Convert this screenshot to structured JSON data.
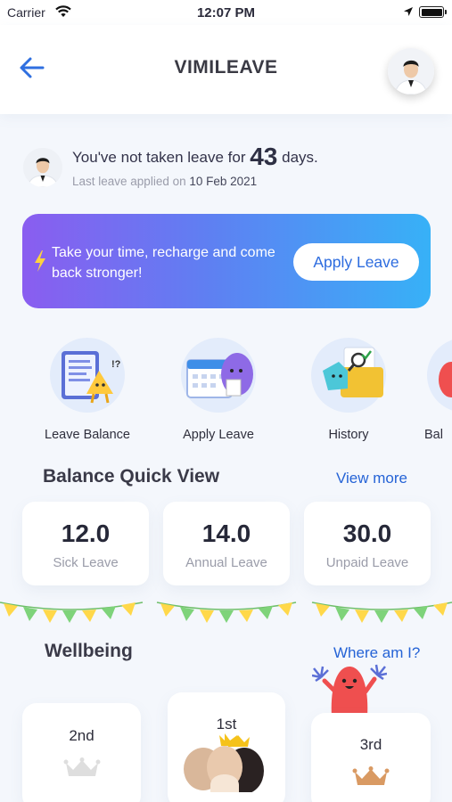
{
  "status_bar": {
    "carrier": "Carrier",
    "time": "12:07 PM"
  },
  "header": {
    "title": "VIMILEAVE",
    "back_icon": "arrow-left-icon",
    "avatar_icon": "profile-avatar"
  },
  "summary": {
    "prefix": "You've not taken leave for",
    "days": "43",
    "suffix": "days.",
    "last_label": "Last leave applied on",
    "last_date": "10 Feb 2021"
  },
  "banner": {
    "message": "Take your time, recharge and come back stronger!",
    "button_label": "Apply Leave",
    "icon": "lightning-bolt-icon",
    "gradient_start": "#8a5df0",
    "gradient_end": "#37b1f7"
  },
  "quick_menu": [
    {
      "label": "Leave Balance",
      "icon": "leave-balance-illustration"
    },
    {
      "label": "Apply Leave",
      "icon": "apply-leave-illustration"
    },
    {
      "label": "History",
      "icon": "history-illustration"
    },
    {
      "label": "Bal",
      "icon": "balance-illustration"
    }
  ],
  "balance_quick_view": {
    "title": "Balance Quick View",
    "view_more": "View more",
    "cards": [
      {
        "value": "12.0",
        "label": "Sick Leave"
      },
      {
        "value": "14.0",
        "label": "Annual Leave"
      },
      {
        "value": "30.0",
        "label": "Unpaid Leave"
      }
    ]
  },
  "wellbeing": {
    "title": "Wellbeing",
    "where_link": "Where am I?",
    "ranks": [
      "2nd",
      "1st",
      "3rd"
    ],
    "icons": [
      "silver-crown-icon",
      "gold-crown-icon",
      "bronze-crown-icon"
    ]
  },
  "colors": {
    "accent": "#2563d6",
    "bunting_green": "#7ed37a",
    "bunting_yellow": "#ffd84a",
    "mascot_red": "#ef4f4f"
  }
}
